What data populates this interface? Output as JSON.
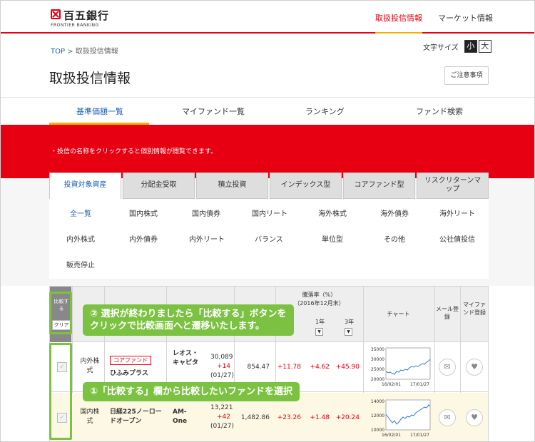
{
  "header": {
    "logo_name": "百五銀行",
    "logo_sub": "FRONTIER BANKING",
    "nav": [
      "取扱投信情報",
      "マーケット情報"
    ]
  },
  "breadcrumb": {
    "home": "TOP",
    "separator": " > ",
    "current": "取扱投信情報"
  },
  "font_size": {
    "label": "文字サイズ",
    "small": "小",
    "large": "大",
    "selected": "小"
  },
  "page_title": "取扱投信情報",
  "notice_button": "ご注意事項",
  "tabs": [
    "基準価額一覧",
    "マイファンド一覧",
    "ランキング",
    "ファンド検索"
  ],
  "banner_message": "投信の名称をクリックすると個別情報が閲覧できます。",
  "category_tabs": [
    "投資対象資産",
    "分配金受取",
    "積立投資",
    "インデックス型",
    "コアファンド型",
    "リスクリターンマップ"
  ],
  "sub_categories": [
    "全一覧",
    "国内株式",
    "国内債券",
    "国内リート",
    "海外株式",
    "海外債券",
    "海外リート",
    "内外株式",
    "内外債券",
    "内外リート",
    "バランス",
    "単位型",
    "その他",
    "公社債投信",
    "販売停止"
  ],
  "table": {
    "compare_label": "比較する",
    "clear_label": "クリア",
    "headers": {
      "drawdown": "騰落率（%）",
      "drawdown_sub": "（2016年12月末）",
      "y1": "1年",
      "y3": "3年",
      "chart": "チャート",
      "mail": "メール登録",
      "myfund": "マイファンド登録"
    },
    "rows": [
      {
        "asset": "内外株式",
        "tag": "コアファンド",
        "name": "ひふみプラス",
        "company": "レオス・キャピタ",
        "nav": "30,089",
        "change": "+14",
        "date": "(01/27)",
        "assets": "854.47",
        "r1": "+11.78",
        "r2": "+4.62",
        "r3": "+45.90",
        "chart": {
          "ylabels": [
            "35000",
            "30000",
            "25000",
            "20000"
          ],
          "xlabels": [
            "16/02/01",
            "17/01/27"
          ]
        }
      },
      {
        "asset": "国内株式",
        "tag": "",
        "name": "日経225ノーロードオープン",
        "company": "AM-One",
        "nav": "13,221",
        "change": "+42",
        "date": "(01/27)",
        "assets": "1,482.86",
        "r1": "+23.26",
        "r2": "+1.48",
        "r3": "+20.24",
        "chart": {
          "ylabels": [
            "14000",
            "12000",
            "10000"
          ],
          "xlabels": [
            "16/02/01",
            "17/01/27"
          ]
        }
      }
    ]
  },
  "callouts": {
    "step2": "② 選択が終わりましたら「比較する」ボタンを\nクリックで比較画面へと遷移いたします。",
    "step1": "①「比較する」欄から比較したいファンドを選択"
  },
  "colors": {
    "brand_red": "#e60012",
    "accent_yellow": "#f2b000",
    "link_blue": "#1a5fb4",
    "callout_green": "#7cc242"
  }
}
